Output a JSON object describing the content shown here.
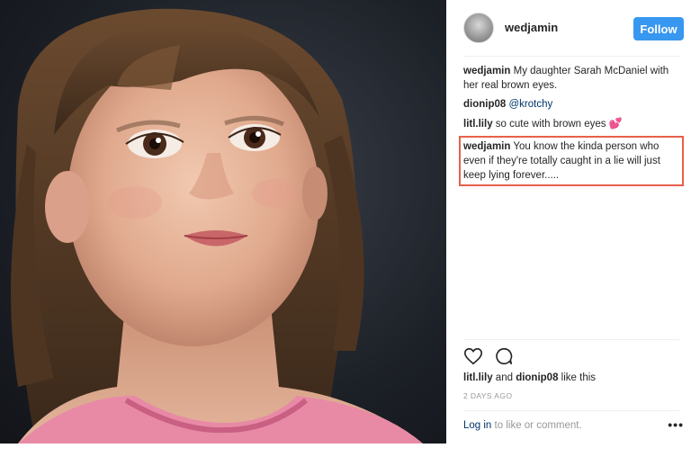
{
  "post": {
    "username": "wedjamin",
    "follow_label": "Follow"
  },
  "comments": [
    {
      "user": "wedjamin",
      "text": "My daughter Sarah McDaniel with her real brown eyes."
    },
    {
      "user": "dionip08",
      "mention": "@krotchy"
    },
    {
      "user": "litl.lily",
      "text": "so cute with brown eyes",
      "emoji": "💕"
    },
    {
      "user": "wedjamin",
      "text": "You know the kinda person who even if they're totally caught in a lie will just keep lying forever.....",
      "highlighted": true
    }
  ],
  "likes": {
    "user1": "litl.lily",
    "and": "and",
    "user2": "dionip08",
    "suffix": "like this"
  },
  "timestamp": "2 DAYS AGO",
  "login": {
    "link": "Log in",
    "rest": "to like or comment."
  },
  "icons": {
    "like": "heart-outline-icon",
    "comment": "comment-bubble-icon",
    "more": "more-dots-icon"
  },
  "colors": {
    "follow_button": "#3897f0",
    "highlight_border": "#e8604a",
    "link": "#003569"
  },
  "photo": {
    "description_visible": false
  }
}
